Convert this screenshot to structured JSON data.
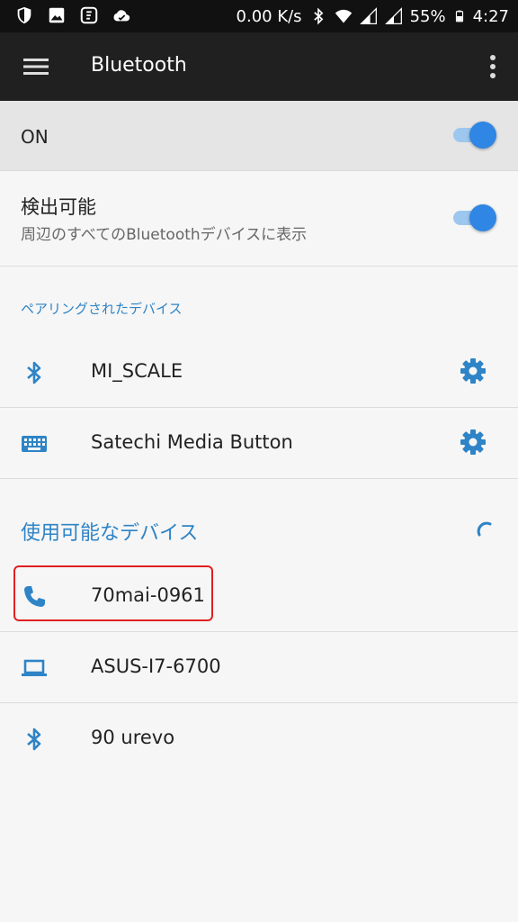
{
  "status_bar": {
    "speed": "0.00 K/s",
    "battery": "55%",
    "time": "4:27"
  },
  "app_bar": {
    "title": "Bluetooth"
  },
  "bluetooth_toggle": {
    "label": "ON",
    "enabled": true
  },
  "discoverable": {
    "title": "検出可能",
    "subtitle": "周辺のすべてのBluetoothデバイスに表示",
    "enabled": true
  },
  "paired_section": {
    "header": "ペアリングされたデバイス",
    "devices": [
      {
        "name": "MI_SCALE",
        "icon": "bluetooth-icon"
      },
      {
        "name": "Satechi Media Button",
        "icon": "keyboard-icon"
      }
    ]
  },
  "available_section": {
    "header": "使用可能なデバイス",
    "devices": [
      {
        "name": "70mai-0961",
        "icon": "phone-icon"
      },
      {
        "name": "ASUS-I7-6700",
        "icon": "laptop-icon"
      },
      {
        "name": "90 urevo",
        "icon": "bluetooth-icon"
      }
    ]
  },
  "colors": {
    "accent": "#2e84c6",
    "toggle_thumb": "#2f86e4",
    "highlight": "#e02020"
  }
}
